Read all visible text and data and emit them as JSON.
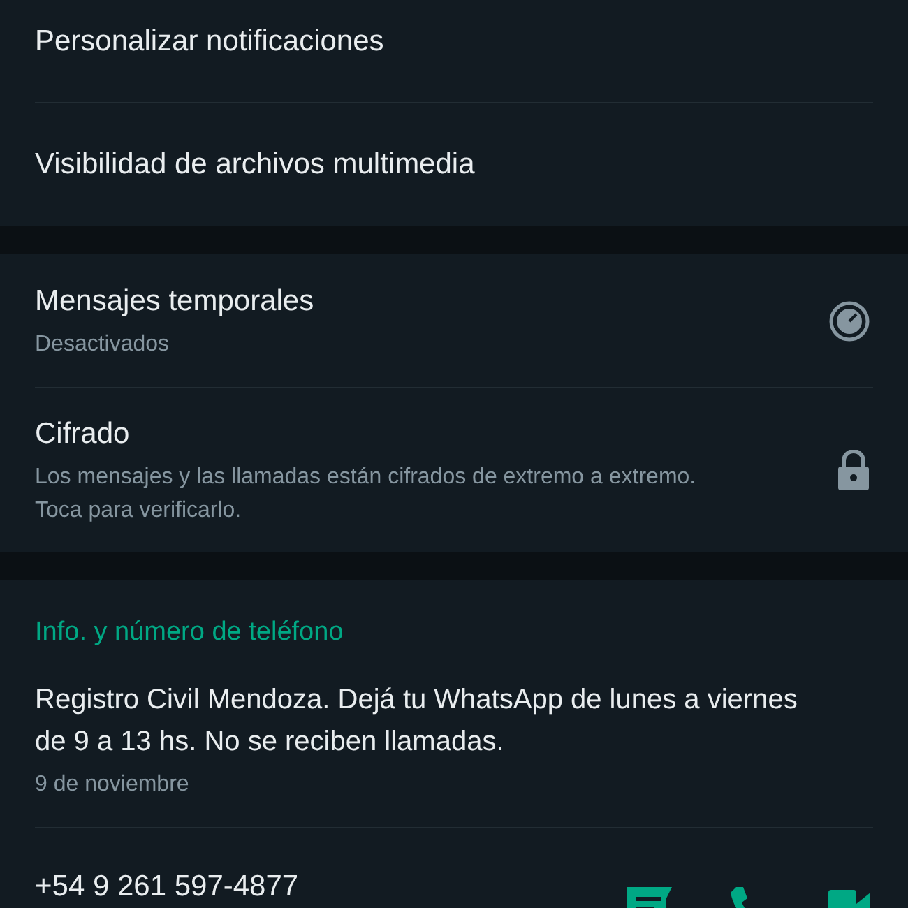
{
  "sections": [
    {
      "rows": [
        {
          "title": "Personalizar notificaciones"
        },
        {
          "title": "Visibilidad de archivos multimedia"
        }
      ]
    },
    {
      "rows": [
        {
          "title": "Mensajes temporales",
          "subtitle": "Desactivados"
        },
        {
          "title": "Cifrado",
          "subtitle": "Los mensajes y las llamadas están cifrados de extremo a extremo. Toca para verificarlo."
        }
      ]
    }
  ],
  "info": {
    "header": "Info. y número de teléfono",
    "about": "Registro Civil Mendoza. Dejá tu WhatsApp de lunes a viernes de 9 a 13 hs. No se reciben llamadas.",
    "date": "9 de noviembre",
    "phone": "+54 9 261 597-4877"
  }
}
